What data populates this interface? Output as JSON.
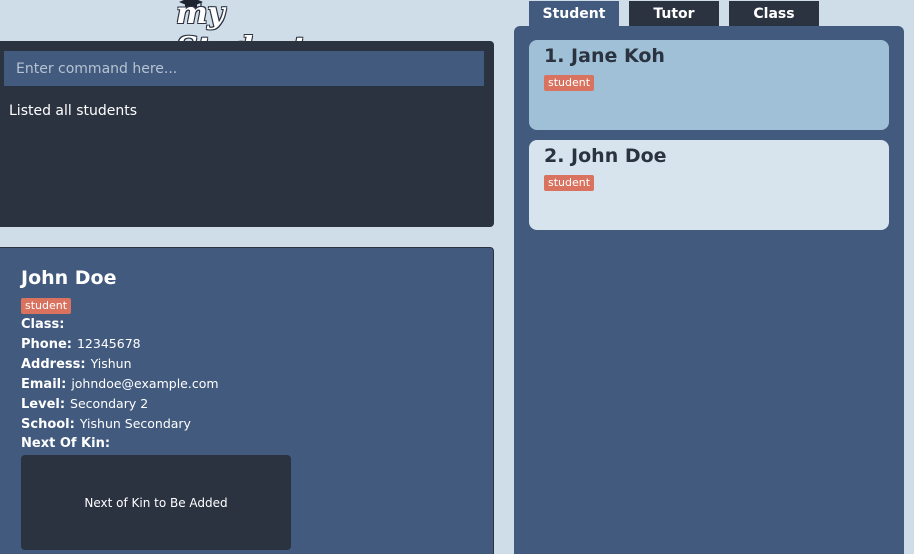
{
  "logo": {
    "text": "my Student"
  },
  "command": {
    "placeholder": "Enter command here...",
    "result": "Listed all students"
  },
  "detail": {
    "name": "John Doe",
    "tag": "student",
    "fields": {
      "class_label": "Class:",
      "class_value": "",
      "phone_label": "Phone:",
      "phone_value": "12345678",
      "address_label": "Address:",
      "address_value": "Yishun",
      "email_label": "Email:",
      "email_value": "johndoe@example.com",
      "level_label": "Level:",
      "level_value": "Secondary 2",
      "school_label": "School:",
      "school_value": "Yishun Secondary",
      "kin_label": "Next Of Kin:"
    },
    "next_of_kin_placeholder": "Next of Kin to Be Added"
  },
  "tabs": [
    {
      "label": "Student",
      "active": true
    },
    {
      "label": "Tutor",
      "active": false
    },
    {
      "label": "Class",
      "active": false
    }
  ],
  "list": {
    "items": [
      {
        "title": "1. Jane Koh",
        "tag": "student",
        "selected": true
      },
      {
        "title": "2. John Doe",
        "tag": "student",
        "selected": false
      }
    ]
  },
  "colors": {
    "background": "#cfdde8",
    "panel_dark": "#2b3240",
    "panel_blue": "#425a7e",
    "tag": "#d9725f",
    "card_selected": "#9fc0d6",
    "card_normal": "#d7e4ee"
  }
}
